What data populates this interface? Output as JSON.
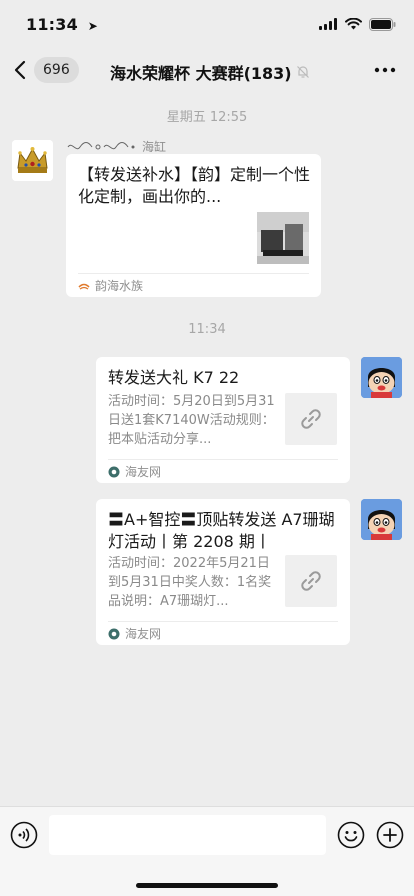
{
  "status_bar": {
    "time": "11:34",
    "location_arrow": "➤",
    "icons": [
      "signal-icon",
      "wifi-icon",
      "battery-icon"
    ]
  },
  "nav": {
    "unread_count": "696",
    "title": "海水荣耀杯 大赛群(183)",
    "mute_icon": "muted-bell-icon",
    "more_icon": "more-icon"
  },
  "messages": {
    "timestamp_1": "星期五 12:55",
    "msg1": {
      "sender_name": "海缸",
      "title": "【转发送补水】【韵】定制一个性化定制，画出你的...",
      "source": "韵海水族"
    },
    "timestamp_2": "11:34",
    "msg2": {
      "title": "转发送大礼 K7 22",
      "desc": "活动时间：5月20日到5月31日送1套K7140W活动规则：把本贴活动分享...",
      "source": "海友网"
    },
    "msg3": {
      "title": "〓A+智控〓顶贴转发送 A7珊瑚灯活动丨第 2208 期丨",
      "desc": "活动时间：2022年5月21日到5月31日中奖人数：1名奖品说明：A7珊瑚灯...",
      "source": "海友网"
    }
  },
  "input_bar": {
    "voice_icon": "voice-icon",
    "emoji_icon": "emoji-icon",
    "plus_icon": "plus-icon",
    "input_value": ""
  },
  "colors": {
    "background": "#ededed",
    "bubble": "#ffffff",
    "muted_text": "#8a8a8a"
  }
}
